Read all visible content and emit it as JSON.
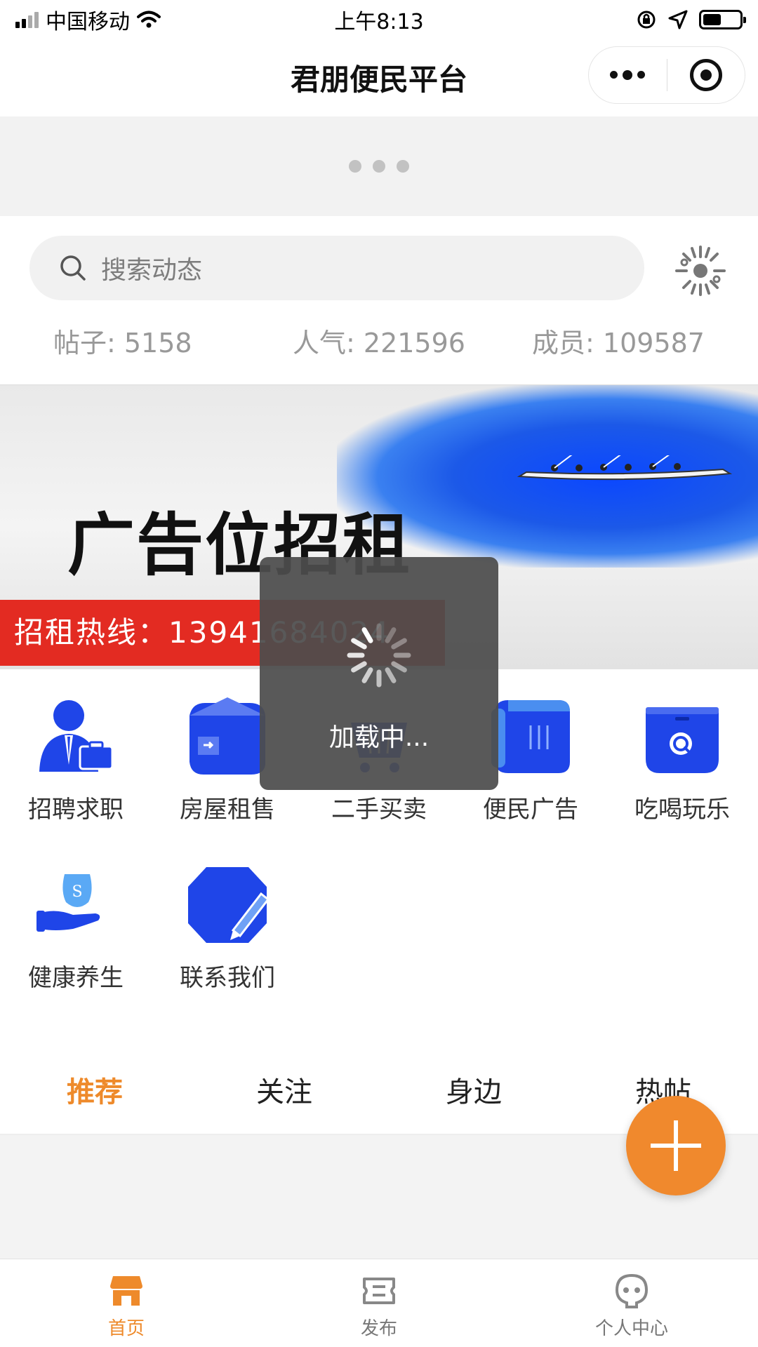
{
  "status_bar": {
    "carrier": "中国移动",
    "time": "上午8:13",
    "battery_level": 0.5
  },
  "nav": {
    "title": "君朋便民平台",
    "more_icon": "more-dots-icon",
    "close_icon": "target-circle-icon"
  },
  "search": {
    "placeholder": "搜索动态",
    "search_icon": "search-icon",
    "scan_icon": "scan-icon"
  },
  "stats": {
    "posts": "帖子: 5158",
    "popularity": "人气: 221596",
    "members": "成员: 109587"
  },
  "banner": {
    "headline": "广告位招租",
    "hotline": "招租热线：13941684024"
  },
  "categories": [
    {
      "label": "招聘求职",
      "icon": "recruitment-icon"
    },
    {
      "label": "房屋租售",
      "icon": "house-icon"
    },
    {
      "label": "二手买卖",
      "icon": "cart-icon"
    },
    {
      "label": "便民广告",
      "icon": "ads-icon"
    },
    {
      "label": "吃喝玩乐",
      "icon": "food-fun-icon"
    },
    {
      "label": "健康养生",
      "icon": "health-icon"
    },
    {
      "label": "联系我们",
      "icon": "contact-icon"
    }
  ],
  "tabs": [
    "推荐",
    "关注",
    "身边",
    "热帖"
  ],
  "active_tab": "推荐",
  "tabbar": [
    {
      "label": "首页",
      "icon": "home-store-icon",
      "active": true
    },
    {
      "label": "发布",
      "icon": "publish-icon",
      "active": false
    },
    {
      "label": "个人中心",
      "icon": "profile-icon",
      "active": false
    }
  ],
  "toast": {
    "text": "加载中..."
  },
  "colors": {
    "accent": "#ee8a2b",
    "fab": "#f0892d",
    "icon_blue": "#1f45e8",
    "hotline_red": "#e32b22"
  }
}
